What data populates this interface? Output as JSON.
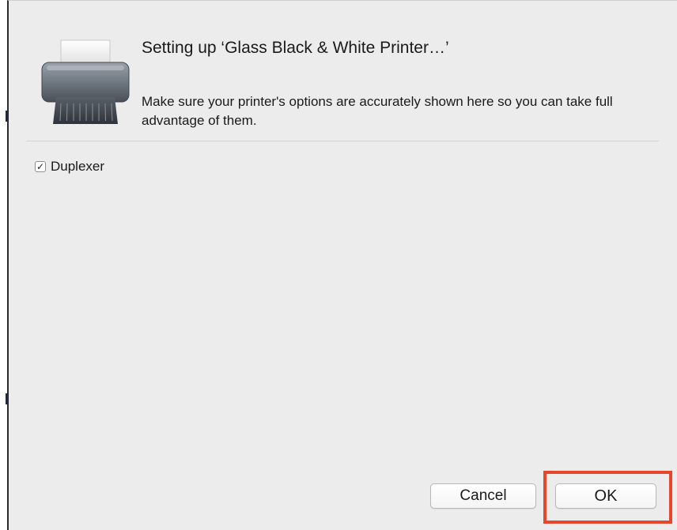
{
  "dialog": {
    "title": "Setting up ‘Glass Black & White Printer…’",
    "message": "Make sure your printer's options are accurately shown here so you can take full advantage of them.",
    "icon": "printer-icon"
  },
  "options": [
    {
      "label": "Duplexer",
      "checked": true,
      "check_glyph": "✓"
    }
  ],
  "buttons": {
    "cancel_label": "Cancel",
    "ok_label": "OK"
  },
  "annotation": {
    "highlight_color": "#e8462a"
  }
}
